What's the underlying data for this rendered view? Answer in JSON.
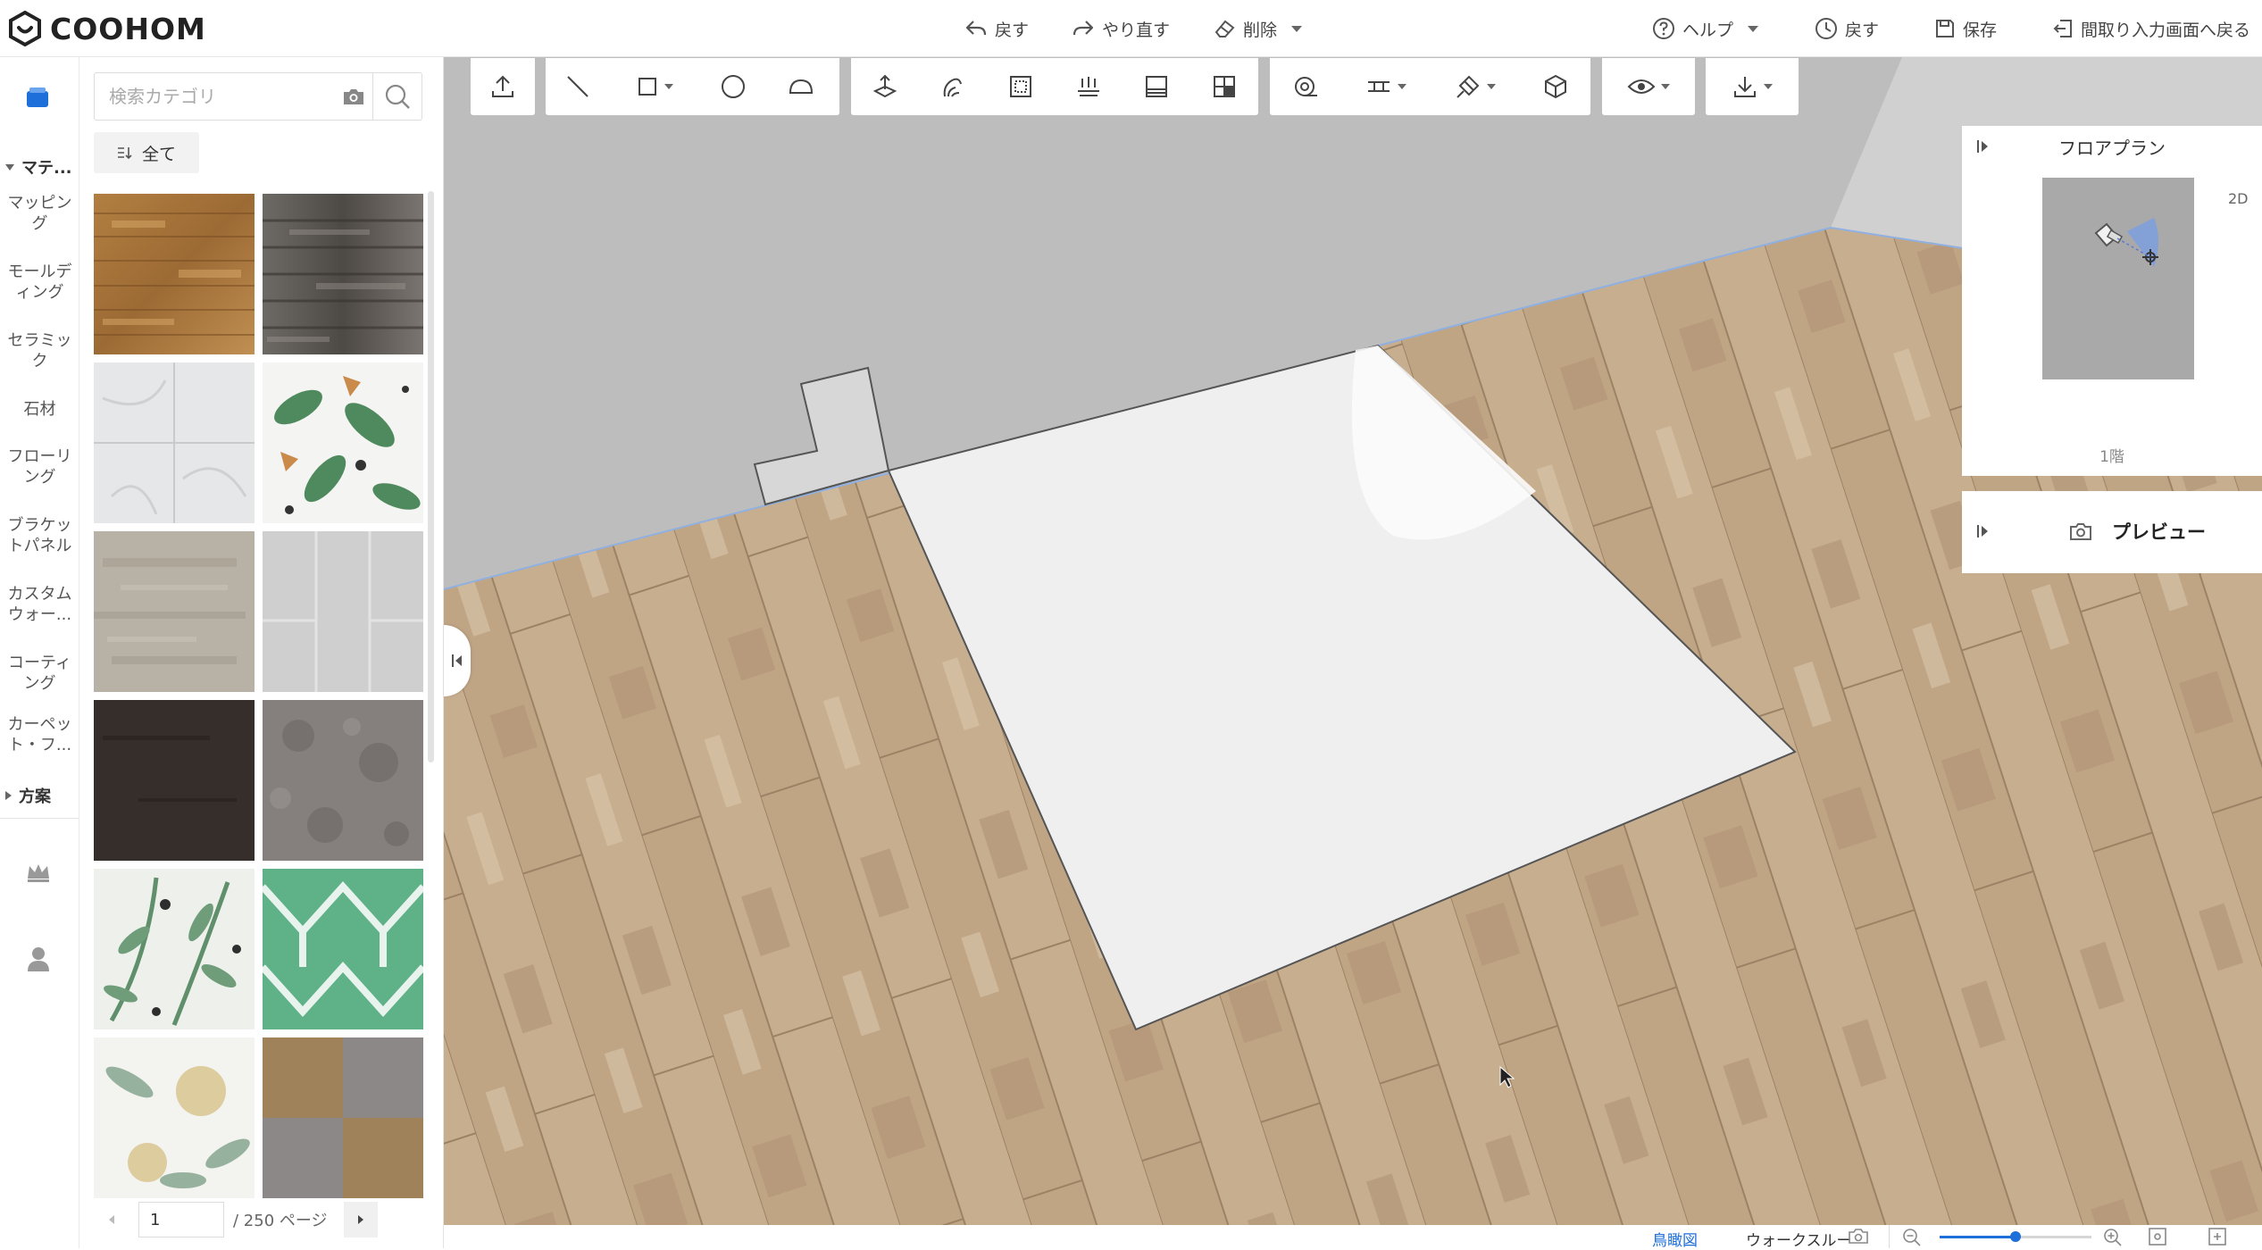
{
  "app": {
    "logo_text": "COOHOM"
  },
  "topbar": {
    "undo": "戻す",
    "redo": "やり直す",
    "delete": "削除",
    "help": "ヘルプ",
    "history": "戻す",
    "save": "保存",
    "back_to_floorplan": "間取り入力画面へ戻る"
  },
  "rail": {
    "materials_group": "マテ...",
    "items": [
      "マッピング",
      "モールディング",
      "セラミック",
      "石材",
      "フローリング",
      "ブラケットパネル",
      "カスタムウォー...",
      "コーティング",
      "カーペット・フ..."
    ],
    "scheme_group": "方案"
  },
  "catalog": {
    "search_placeholder": "検索カテゴリ",
    "all_label": "全て",
    "tiles": [
      "wood-amber",
      "wood-gray",
      "marble-white",
      "tropical-leaf",
      "stone-beige",
      "tile-gray",
      "dark-brown",
      "granite-gray",
      "leaf-pattern",
      "green-geometric",
      "floral-watercolor",
      "carpet-checker"
    ],
    "pager": {
      "current": "1",
      "total_label": "/ 250 ページ"
    }
  },
  "rightpanel": {
    "floorplan_title": "フロアプラン",
    "view_mode": "2D",
    "floor_label": "1階",
    "preview_title": "プレビュー"
  },
  "bottombar": {
    "birdseye": "鳥瞰図",
    "walkthrough": "ウォークスルー",
    "zoom_level": 0.5
  },
  "colors": {
    "accent": "#1e6fd9",
    "wall": "#bcbcbc",
    "floor": "#c6ad8e",
    "rug": "#f0f0f0"
  }
}
